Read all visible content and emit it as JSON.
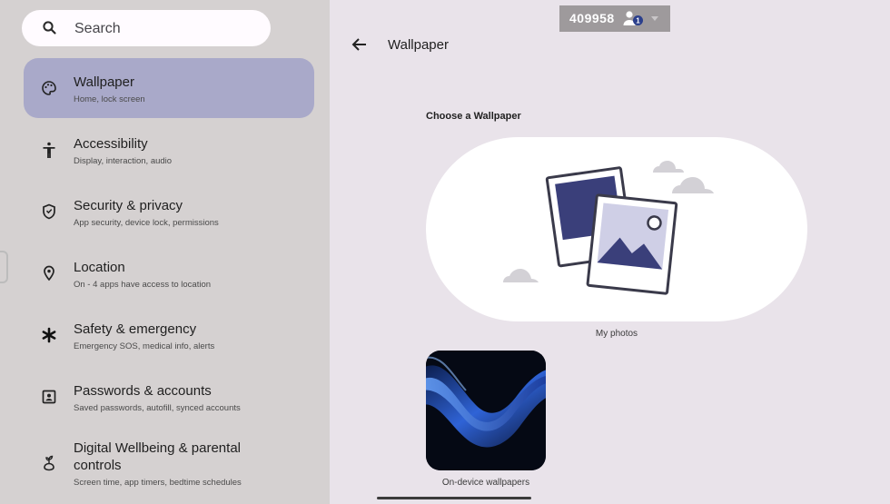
{
  "search": {
    "label": "Search"
  },
  "nav_items": [
    {
      "title": "Wallpaper",
      "subtitle": "Home, lock screen",
      "icon": "palette-icon",
      "selected": true
    },
    {
      "title": "Accessibility",
      "subtitle": "Display, interaction, audio",
      "icon": "accessibility-icon"
    },
    {
      "title": "Security & privacy",
      "subtitle": "App security, device lock, permissions",
      "icon": "shield-icon"
    },
    {
      "title": "Location",
      "subtitle": "On - 4 apps have access to location",
      "icon": "location-pin-icon"
    },
    {
      "title": "Safety & emergency",
      "subtitle": "Emergency SOS, medical info, alerts",
      "icon": "asterisk-icon"
    },
    {
      "title": "Passwords & accounts",
      "subtitle": "Saved passwords, autofill, synced accounts",
      "icon": "account-box-icon"
    },
    {
      "title": "Digital Wellbeing & parental controls",
      "subtitle": "Screen time, app timers, bedtime schedules",
      "icon": "wellbeing-icon"
    }
  ],
  "header": {
    "title": "Wallpaper",
    "back_icon": "arrow-back-icon"
  },
  "user_badge": {
    "id": "409958"
  },
  "section": {
    "heading": "Choose a Wallpaper"
  },
  "options": {
    "my_photos": "My photos",
    "on_device": "On-device wallpapers"
  },
  "colors": {
    "sidebar_bg": "#d5d1d1",
    "selected_item": "#a9a9c9",
    "content_bg": "#e9e3ea",
    "illustration_accent": "#3a3f7a"
  }
}
